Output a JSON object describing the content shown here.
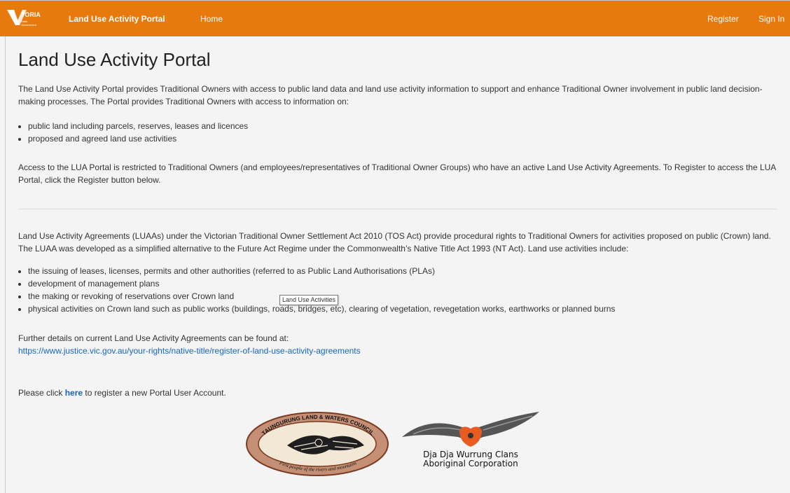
{
  "navbar": {
    "logo_text": "VICTORIA",
    "logo_subtext": "State Government",
    "brand": "Land Use Activity Portal",
    "home": "Home",
    "register": "Register",
    "sign_in": "Sign In",
    "color": "#e8790d"
  },
  "page": {
    "title": "Land Use Activity Portal",
    "intro": "The Land Use Activity Portal provides Traditional Owners with access to public land data and land use activity information to support and enhance Traditional Owner involvement in public land decision-making processes. The Portal provides Traditional Owners with access to information on:",
    "intro_items": [
      "public land including parcels, reserves, leases and licences",
      "proposed and agreed land use activities"
    ],
    "access": "Access to the LUA Portal is restricted to Traditional Owners (and employees/representatives of Traditional Owner Groups) who have an active Land Use Activity Agreements. To Register to access the LUA Portal, click the Register button below.",
    "luaa": "Land Use Activity Agreements (LUAAs) under the Victorian Traditional Owner Settlement Act 2010 (TOS Act) provide procedural rights to Traditional Owners for activities proposed on public (Crown) land. The LUAA was developed as a simplified alternative to the Future Act Regime under the Commonwealth’s Native Title Act 1993 (NT Act).  Land use activities include:",
    "activities": [
      "the issuing of leases, licenses, permits and other authorities (referred to as Public Land Authorisations (PLAs)",
      "development of management plans",
      "the making or revoking of reservations over Crown land",
      "physical activities on Crown land such as public works (buildings, roads, bridges, etc), clearing of vegetation, revegetation works, earthworks or planned burns"
    ],
    "further": "Further details on current Land Use Activity Agreements can be found at:",
    "further_link": "https://www.justice.vic.gov.au/your-rights/native-title/register-of-land-use-activity-agreements",
    "click_pre": "Please click ",
    "click_here": "here",
    "click_post": " to register a new Portal User Account.",
    "tooltip": "Land Use Activities"
  },
  "logos": {
    "taungurung_top": "TAUNGURUNG LAND & WATERS COUNCIL",
    "taungurung_bottom": "First people of the rivers and mountains",
    "dja_line1": "Dja Dja Wurrung Clans",
    "dja_line2": "Aboriginal Corporation"
  }
}
